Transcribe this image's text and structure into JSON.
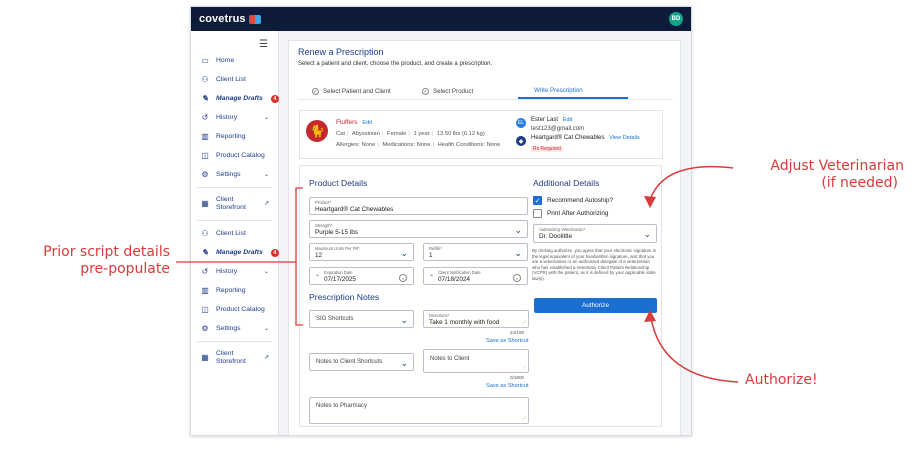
{
  "app": {
    "logo": "covetrus",
    "avatar_initials": "BD"
  },
  "sidebar": {
    "group1": [
      {
        "label": "Home",
        "icon": "monitor-icon"
      },
      {
        "label": "Client List",
        "icon": "users-icon"
      },
      {
        "label": "Manage Drafts",
        "icon": "pencil-icon",
        "badge": "4"
      },
      {
        "label": "History",
        "icon": "history-icon"
      },
      {
        "label": "Reporting",
        "icon": "chart-icon"
      },
      {
        "label": "Product Catalog",
        "icon": "book-icon"
      },
      {
        "label": "Settings",
        "icon": "gear-icon"
      },
      {
        "label": "Client Storefront",
        "icon": "store-icon"
      }
    ],
    "group2": [
      {
        "label": "Client List",
        "icon": "users-icon"
      },
      {
        "label": "Manage Drafts",
        "icon": "pencil-icon",
        "badge": "4"
      },
      {
        "label": "History",
        "icon": "history-icon"
      },
      {
        "label": "Reporting",
        "icon": "chart-icon"
      },
      {
        "label": "Product Catalog",
        "icon": "book-icon"
      },
      {
        "label": "Settings",
        "icon": "gear-icon"
      },
      {
        "label": "Client Storefront",
        "icon": "store-icon"
      }
    ]
  },
  "page": {
    "title": "Renew a Prescription",
    "subtitle": "Select a patient and client, choose the product, and create a prescription.",
    "tabs": [
      {
        "label": "Select Patient and Client"
      },
      {
        "label": "Select Product"
      },
      {
        "label": "Write Prescription"
      }
    ]
  },
  "patient": {
    "name": "Fluffers",
    "edit": "Edit",
    "species": "Cat",
    "breed": "Abyssinian",
    "sex": "Female",
    "age": "1 year",
    "weight": "13.50 lbs (6.12 kg)",
    "allergies": "Allergies: None",
    "medications": "Medications: None",
    "conditions": "Health Conditions: None",
    "owner_initials": "EL",
    "owner_name": "Ester Last",
    "owner_email": "test123@gmail.com",
    "product": "Heartgard® Cat Chewables",
    "view_details": "View Details",
    "rx_required": "Rx Required"
  },
  "product_details": {
    "title": "Product Details",
    "product_label": "Product*",
    "product_value": "Heartgard® Cat Chewables",
    "strength_label": "Strength*",
    "strength_value": "Purple 5-15 lbs",
    "max_units_label": "Maximum Units Per Fill*",
    "max_units_value": "12",
    "refills_label": "Refills*",
    "refills_value": "1",
    "expiration_label": "Expiration Date",
    "expiration_value": "07/17/2025",
    "notify_label": "Client Notification Date",
    "notify_value": "07/18/2024"
  },
  "rx_notes": {
    "title": "Prescription Notes",
    "sig_placeholder": "SIG Shortcuts",
    "directions_label": "Directions*",
    "directions_value": "Take 1 monthly with food",
    "directions_counter": "24/180",
    "save_shortcut": "Save as Shortcut",
    "client_shortcuts_placeholder": "Notes to Client Shortcuts",
    "client_notes_placeholder": "Notes to Client",
    "client_counter": "0/1800",
    "save_shortcut2": "Save as Shortcut",
    "pharmacy_placeholder": "Notes to Pharmacy"
  },
  "additional": {
    "title": "Additional Details",
    "autoship": "Recommend Autoship?",
    "autoship_checked": true,
    "print": "Print After Authorizing",
    "print_checked": false,
    "vet_label": "Authorizing Veterinarian*",
    "vet_value": "Dr. Doolittle",
    "disclaimer": "By clicking authorize, you agree that your electronic signature is the legal equivalent of your handwritten signature, and that you are a veterinarian or an authorized delegate of a veterinarian who has established a Veterinary Client Patient Relationship (VCPR) with the patient, as it is defined by your applicable state law(s).",
    "authorize": "Authorize"
  },
  "annotations": {
    "left_line1": "Prior script details",
    "left_line2": "pre-populate",
    "right_top_line1": "Adjust Veterinarian",
    "right_top_line2": "(if needed)",
    "right_bottom": "Authorize!"
  },
  "colors": {
    "accent": "#1a6fd1",
    "navy": "#0f1b3a",
    "annotation": "#d93a3a"
  }
}
